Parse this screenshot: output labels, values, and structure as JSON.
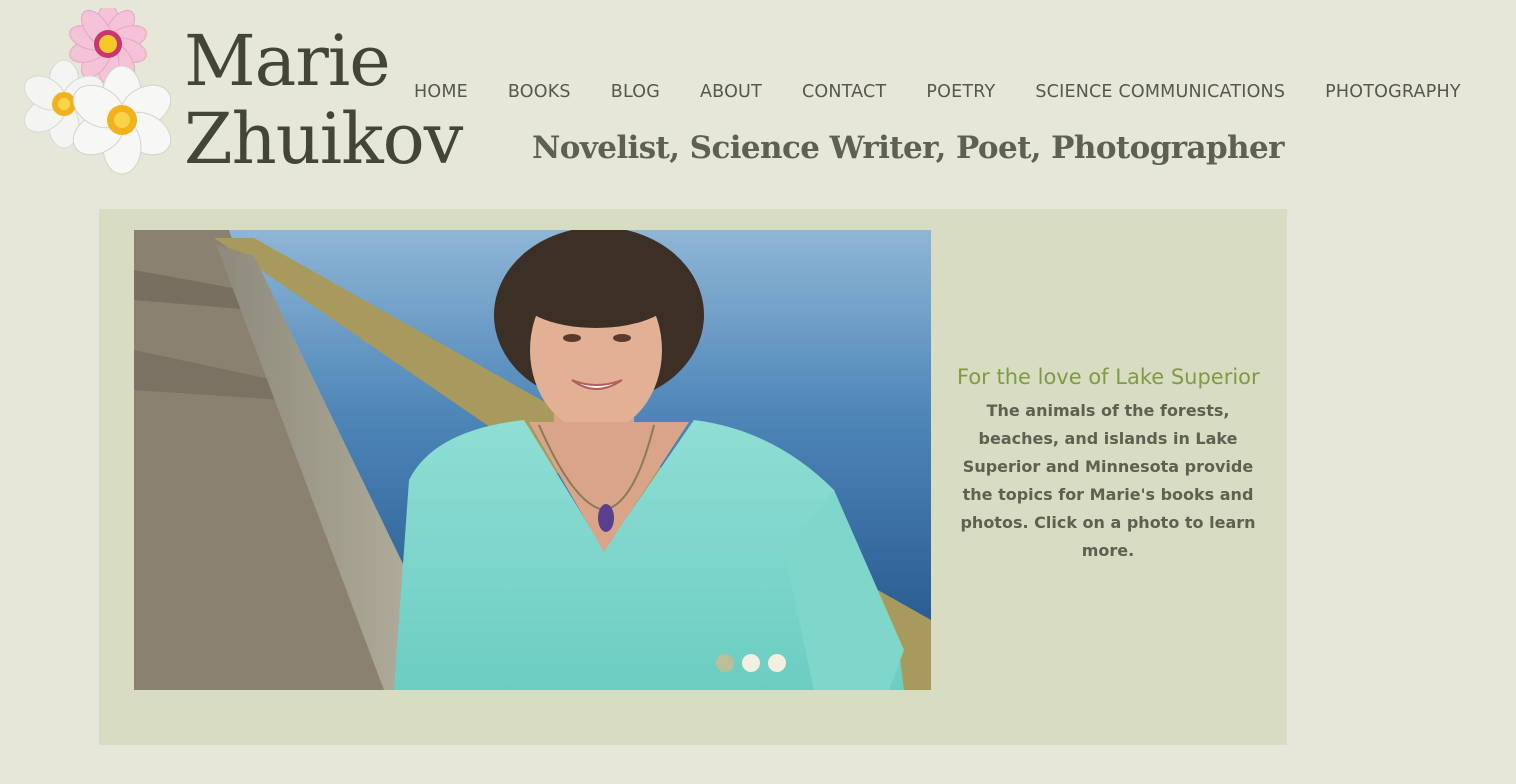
{
  "site": {
    "title_line1": "Marie",
    "title_line2": "Zhuikov",
    "tagline": "Novelist, Science Writer, Poet, Photographer"
  },
  "nav": {
    "items": [
      "HOME",
      "BOOKS",
      "BLOG",
      "ABOUT",
      "CONTACT",
      "POETRY",
      "SCIENCE COMMUNICATIONS",
      "PHOTOGRAPHY"
    ]
  },
  "slider": {
    "caption_title": "For the love of Lake Superior",
    "caption_text": "The animals of the forests, beaches, and islands in Lake Superior and Minnesota provide the topics for Marie's books and photos. Click on a photo to learn more.",
    "active_slide": 1,
    "slide_count": 3
  },
  "colors": {
    "background": "#e6e7d8",
    "panel": "#d7dcc2",
    "accent_green": "#7f9b44",
    "text_dark": "#434637"
  },
  "icons": {
    "logo": "flower-logo-icon"
  }
}
